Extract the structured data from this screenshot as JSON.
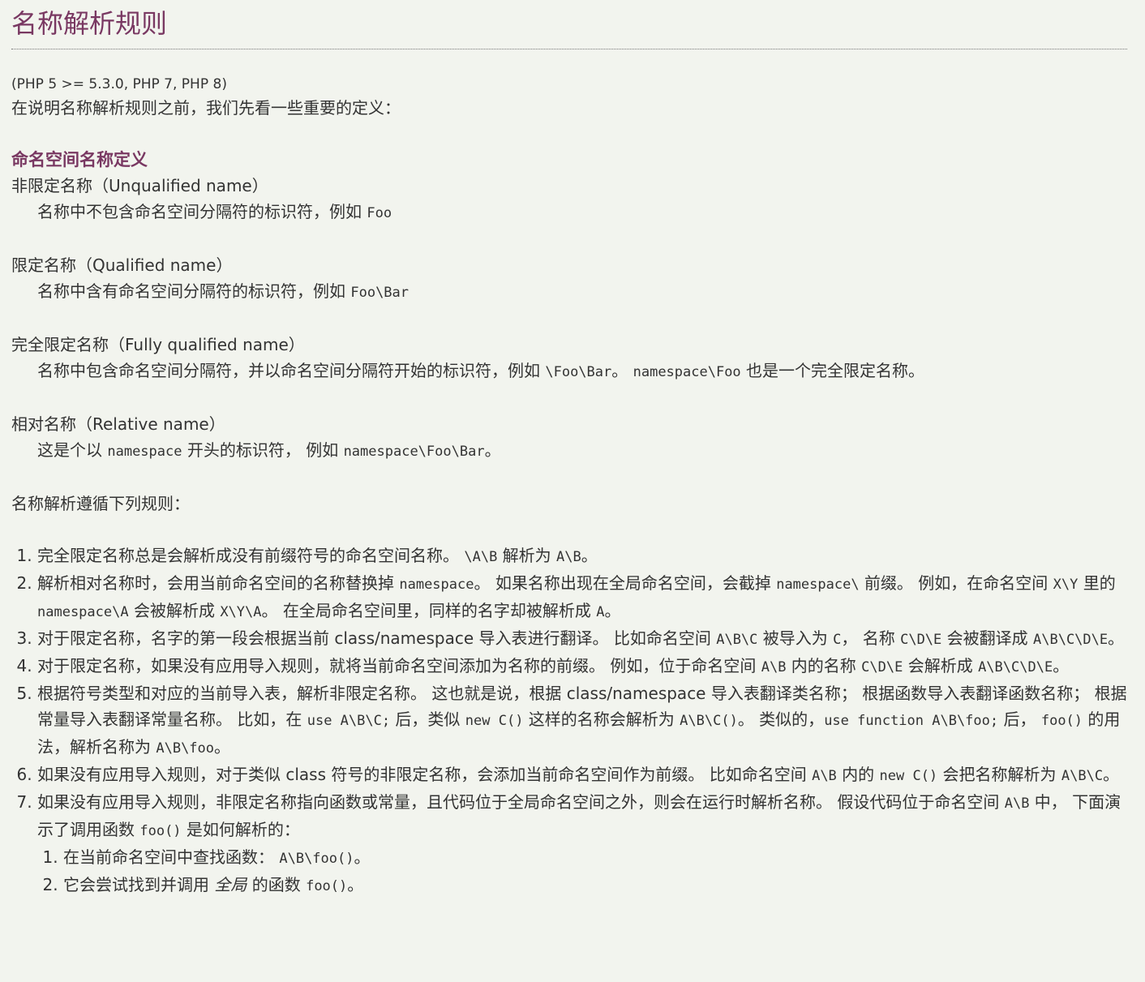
{
  "title": "名称解析规则",
  "version": "(PHP 5 >= 5.3.0, PHP 7, PHP 8)",
  "intro": "在说明名称解析规则之前，我们先看一些重要的定义：",
  "defs_heading": "命名空间名称定义",
  "defs": {
    "d1_term": "非限定名称（Unqualified name）",
    "d1_text": "名称中不包含命名空间分隔符的标识符，例如 ",
    "d1_code": "Foo",
    "d2_term": "限定名称（Qualified name）",
    "d2_text": "名称中含有命名空间分隔符的标识符，例如 ",
    "d2_code": "Foo\\Bar",
    "d3_term": "完全限定名称（Fully qualified name）",
    "d3_t1": "名称中包含命名空间分隔符，并以命名空间分隔符开始的标识符，例如 ",
    "d3_c1": "\\Foo\\Bar",
    "d3_t2": "。 ",
    "d3_c2": "namespace\\Foo",
    "d3_t3": " 也是一个完全限定名称。",
    "d4_term": "相对名称（Relative name）",
    "d4_t1": "这是个以 ",
    "d4_c1": "namespace",
    "d4_t2": " 开头的标识符， 例如 ",
    "d4_c2": "namespace\\Foo\\Bar",
    "d4_t3": "。"
  },
  "rules_lead": "名称解析遵循下列规则：",
  "rules": {
    "r1_t1": "完全限定名称总是会解析成没有前缀符号的命名空间名称。 ",
    "r1_c1": "\\A\\B",
    "r1_t2": " 解析为 ",
    "r1_c2": "A\\B",
    "r1_t3": "。",
    "r2_t1": "解析相对名称时，会用当前命名空间的名称替换掉 ",
    "r2_c1": "namespace",
    "r2_t2": "。 如果名称出现在全局命名空间，会截掉 ",
    "r2_c2": "namespace\\",
    "r2_t3": " 前缀。 例如，在命名空间 ",
    "r2_c3": "X\\Y",
    "r2_t4": " 里的 ",
    "r2_c4": "namespace\\A",
    "r2_t5": " 会被解析成 ",
    "r2_c5": "X\\Y\\A",
    "r2_t6": "。 在全局命名空间里，同样的名字却被解析成 ",
    "r2_c6": "A",
    "r2_t7": "。",
    "r3_t1": "对于限定名称，名字的第一段会根据当前 class/namespace 导入表进行翻译。 比如命名空间 ",
    "r3_c1": "A\\B\\C",
    "r3_t2": " 被导入为 ",
    "r3_c2": "C",
    "r3_t3": "， 名称 ",
    "r3_c3": "C\\D\\E",
    "r3_t4": " 会被翻译成 ",
    "r3_c4": "A\\B\\C\\D\\E",
    "r3_t5": "。",
    "r4_t1": "对于限定名称，如果没有应用导入规则，就将当前命名空间添加为名称的前缀。 例如，位于命名空间 ",
    "r4_c1": "A\\B",
    "r4_t2": " 内的名称 ",
    "r4_c2": "C\\D\\E",
    "r4_t3": " 会解析成 ",
    "r4_c3": "A\\B\\C\\D\\E",
    "r4_t4": "。",
    "r5_t1": "根据符号类型和对应的当前导入表，解析非限定名称。 这也就是说，根据 class/namespace 导入表翻译类名称； 根据函数导入表翻译函数名称； 根据常量导入表翻译常量名称。 比如，在 ",
    "r5_c1": "use A\\B\\C;",
    "r5_t2": " 后，类似 ",
    "r5_c2": "new C()",
    "r5_t3": " 这样的名称会解析为 ",
    "r5_c3": "A\\B\\C()",
    "r5_t4": "。 类似的，",
    "r5_c4": "use function A\\B\\foo;",
    "r5_t5": " 后， ",
    "r5_c5": "foo()",
    "r5_t6": " 的用法，解析名称为 ",
    "r5_c6": "A\\B\\foo",
    "r5_t7": "。",
    "r6_t1": "如果没有应用导入规则，对于类似 class 符号的非限定名称，会添加当前命名空间作为前缀。 比如命名空间 ",
    "r6_c1": "A\\B",
    "r6_t2": " 内的 ",
    "r6_c2": "new C()",
    "r6_t3": " 会把名称解析为 ",
    "r6_c3": "A\\B\\C",
    "r6_t4": "。",
    "r7_t1": "如果没有应用导入规则，非限定名称指向函数或常量，且代码位于全局命名空间之外，则会在运行时解析名称。 假设代码位于命名空间 ",
    "r7_c1": "A\\B",
    "r7_t2": " 中， 下面演示了调用函数 ",
    "r7_c2": "foo()",
    "r7_t3": " 是如何解析的：",
    "s1_t1": "在当前命名空间中查找函数： ",
    "s1_c1": "A\\B\\foo()",
    "s1_t2": "。",
    "s2_t1": "它会尝试找到并调用 ",
    "s2_em": "全局",
    "s2_t2": " 的函数 ",
    "s2_c1": "foo()",
    "s2_t3": "。"
  },
  "colors": {
    "accent": "#793862",
    "text": "#333333",
    "background": "#f2f4ee"
  }
}
